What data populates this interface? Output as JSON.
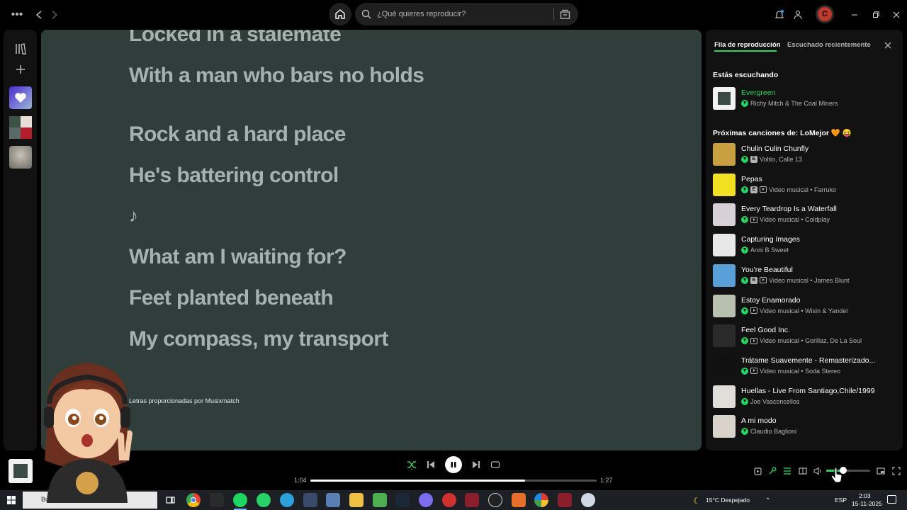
{
  "topbar": {
    "search_placeholder": "¿Qué quieres reproducir?",
    "user_initial": "C"
  },
  "lyrics": {
    "lines": [
      "Locked in a stalemate",
      "With a man who bars no holds",
      "Rock and a hard place",
      "He's battering control",
      "♪",
      "What am I waiting for?",
      "Feet planted beneath",
      "My compass, my transport"
    ],
    "credit": "Letras proporcionadas por Musixmatch"
  },
  "queue": {
    "tab_queue": "Fila de reproducción",
    "tab_recent": "Escuchado recientemente",
    "now_playing_heading": "Estás escuchando",
    "now_playing": {
      "title": "Evergreen",
      "artist": "Richy Mitch & The Coal Miners"
    },
    "next_heading": "Próximas canciones de: LoMejor 🧡 😝",
    "items": [
      {
        "title": "Chulin Culin Chunfly",
        "tag": "E",
        "video": false,
        "sub": "Voltio, Calle 13"
      },
      {
        "title": "Pepas",
        "tag": "E",
        "video": true,
        "sub": "Video musical • Farruko"
      },
      {
        "title": "Every Teardrop Is a Waterfall",
        "tag": "",
        "video": true,
        "sub": "Video musical • Coldplay"
      },
      {
        "title": "Capturing Images",
        "tag": "",
        "video": false,
        "sub": "Anni B Sweet"
      },
      {
        "title": "You're Beautiful",
        "tag": "E",
        "video": true,
        "sub": "Video musical • James Blunt"
      },
      {
        "title": "Estoy Enamorado",
        "tag": "",
        "video": true,
        "sub": "Video musical • Wisin & Yandel"
      },
      {
        "title": "Feel Good Inc.",
        "tag": "",
        "video": true,
        "sub": "Video musical • Gorillaz, De La Soul"
      },
      {
        "title": "Trátame Suavemente - Remasterizado...",
        "tag": "",
        "video": true,
        "sub": "Video musical • Soda Stereo"
      },
      {
        "title": "Huellas - Live From Santiago,Chile/1999",
        "tag": "",
        "video": false,
        "sub": "Joe Vasconcellos"
      },
      {
        "title": "A mi modo",
        "tag": "",
        "video": false,
        "sub": "Claudio Baglioni"
      }
    ]
  },
  "player": {
    "elapsed": "1:04",
    "total": "1:27",
    "progress": 0.75,
    "volume": 0.38
  },
  "taskbar": {
    "search_label": "Buscar",
    "weather": "15°C Despejado",
    "lang": "ESP",
    "time": "2:03",
    "date": "15-11-2025"
  },
  "colors": {
    "accent": "#1ed760",
    "lyrics_bg": "#2f3e3b",
    "lyrics_text": "#a5b3b0"
  }
}
